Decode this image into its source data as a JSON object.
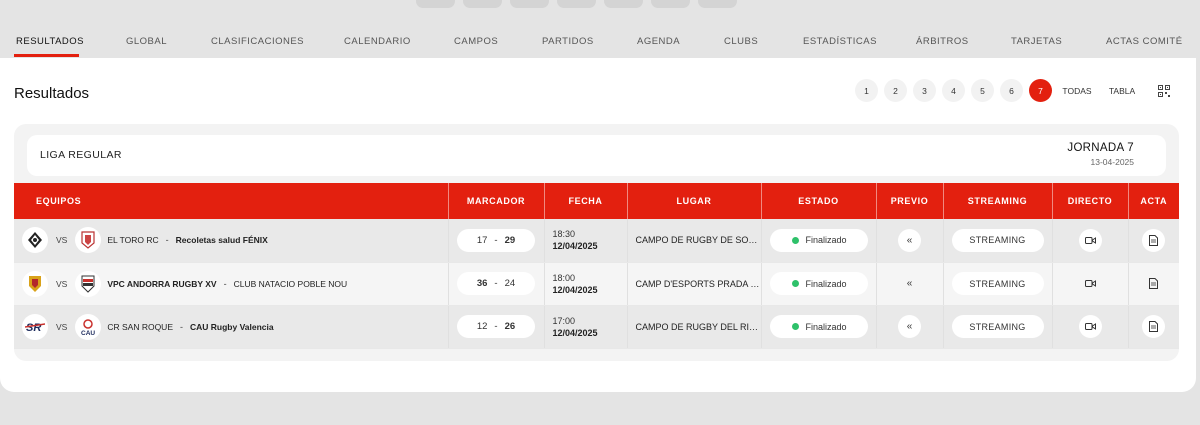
{
  "nav": {
    "tabs": [
      "RESULTADOS",
      "GLOBAL",
      "CLASIFICACIONES",
      "CALENDARIO",
      "CAMPOS",
      "PARTIDOS",
      "AGENDA",
      "CLUBS",
      "ESTADÍSTICAS",
      "ÁRBITROS",
      "TARJETAS",
      "ACTAS COMITÉ"
    ],
    "active": "RESULTADOS"
  },
  "page": {
    "title": "Resultados"
  },
  "pager": {
    "pages": [
      "1",
      "2",
      "3",
      "4",
      "5",
      "6",
      "7"
    ],
    "active": "7",
    "all_label": "TODAS",
    "table_label": "TABLA",
    "qr_icon": "qr-code-icon"
  },
  "round": {
    "league": "LIGA REGULAR",
    "jornada": "JORNADA 7",
    "date": "13-04-2025"
  },
  "table": {
    "headers": [
      "EQUIPOS",
      "MARCADOR",
      "FECHA",
      "LUGAR",
      "ESTADO",
      "PREVIO",
      "STREAMING",
      "DIRECTO",
      "ACTA"
    ],
    "vs_label": "VS",
    "rows": [
      {
        "home": "EL TORO RC",
        "away": "Recoletas salud FÉNIX",
        "winner": "away",
        "home_score": "17",
        "away_score": "29",
        "time": "18:30",
        "date": "12/04/2025",
        "venue": "CAMPO DE RUGBY DE SON …",
        "status": "Finalizado",
        "streaming": "STREAMING"
      },
      {
        "home": "VPC ANDORRA RUGBY XV",
        "away": "CLUB NATACIO POBLE NOU",
        "winner": "home",
        "home_score": "36",
        "away_score": "24",
        "time": "18:00",
        "date": "12/04/2025",
        "venue": "CAMP D'ESPORTS PRADA D…",
        "status": "Finalizado",
        "streaming": "STREAMING"
      },
      {
        "home": "CR SAN ROQUE",
        "away": "CAU Rugby Valencia",
        "winner": "away",
        "home_score": "12",
        "away_score": "26",
        "time": "17:00",
        "date": "12/04/2025",
        "venue": "CAMPO DE RUGBY DEL RIO …",
        "status": "Finalizado",
        "streaming": "STREAMING"
      }
    ]
  },
  "colors": {
    "accent": "#e3200f",
    "status_finalizado": "#2ec16a"
  }
}
